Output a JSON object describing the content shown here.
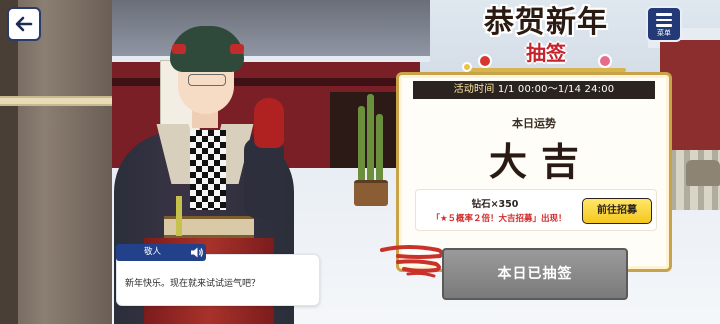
{
  "nav": {
    "back_icon": "back-arrow-icon",
    "menu_icon": "hamburger-menu-icon",
    "menu_label": "菜单"
  },
  "event": {
    "title_main": "恭贺新年",
    "title_sub": "抽签",
    "period_label": "活动时间",
    "period_value": "1/1 00:00～1/14 24:00"
  },
  "fortune": {
    "label": "本日运势",
    "result": "大吉"
  },
  "reward": {
    "amount": "钻石×350",
    "note": "「★５概率２倍！大吉招募」出现！",
    "gacha_button": "前往招募"
  },
  "draw": {
    "status_button": "本日已抽签"
  },
  "dialog": {
    "speaker": "敬人",
    "voice_icon": "speaker-volume-icon",
    "text": "新年快乐。现在就来试试运气吧？"
  },
  "colors": {
    "accent_navy": "#233a76",
    "gold_border": "#c9a34a",
    "result_red": "#d32a2a",
    "button_yellow": "#f5c71d",
    "disabled_gray": "#8a8a8a"
  }
}
